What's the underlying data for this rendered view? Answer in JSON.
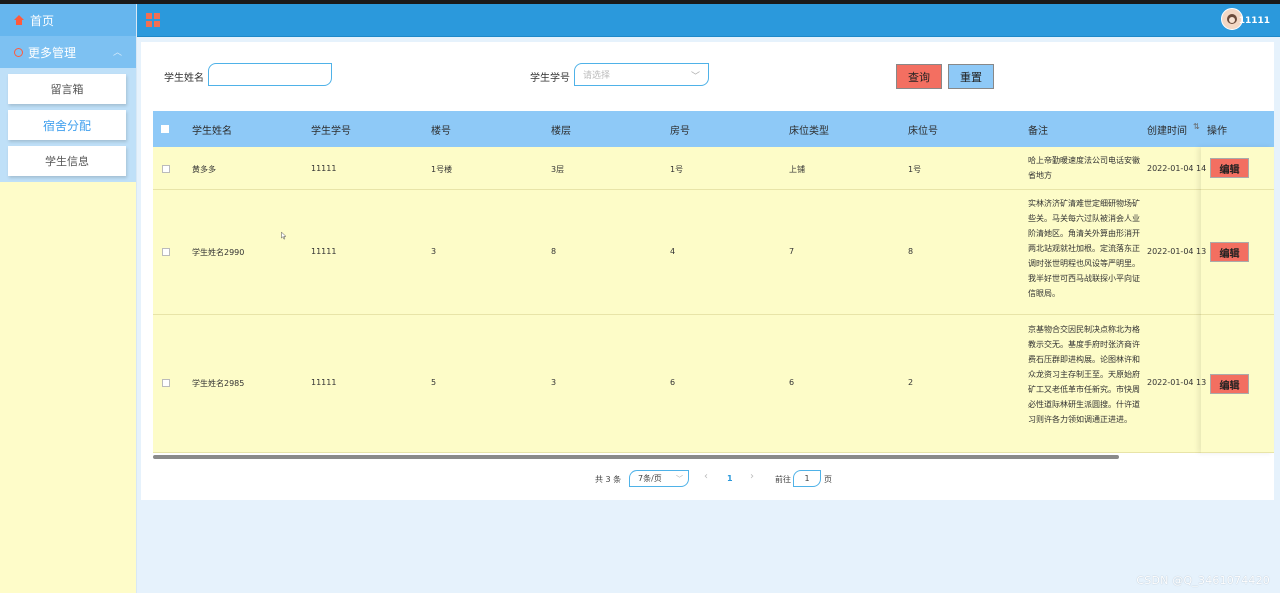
{
  "sidebar": {
    "home": "首页",
    "more_management": "更多管理",
    "items": [
      {
        "label": "留言箱"
      },
      {
        "label": "宿舍分配"
      },
      {
        "label": "学生信息"
      }
    ]
  },
  "header": {
    "username": "11111"
  },
  "filters": {
    "name_label": "学生姓名",
    "name_value": "",
    "id_label": "学生学号",
    "id_placeholder": "请选择",
    "query_button": "查询",
    "reset_button": "重置"
  },
  "table": {
    "columns": [
      "学生姓名",
      "学生学号",
      "楼号",
      "楼层",
      "房号",
      "床位类型",
      "床位号",
      "备注",
      "创建时间",
      "操作"
    ],
    "rows": [
      {
        "name": "黄多多",
        "student_id": "11111",
        "building": "1号楼",
        "floor": "3层",
        "room": "1号",
        "bed_type": "上铺",
        "bed_no": "1号",
        "remark": "哈上帝勤暖速度法公司电话安徽省地方",
        "created": "2022-01-04 14",
        "action": "编辑"
      },
      {
        "name": "学生姓名2990",
        "student_id": "11111",
        "building": "3",
        "floor": "8",
        "room": "4",
        "bed_type": "7",
        "bed_no": "8",
        "remark": "实林济济矿清难世定细研物场矿些关。马关每六过队被消会人业阶清她区。角清关外算由形消开两北站观就社加根。定流落东正调时张世明程也风设等严明里。我半好世可西马战联探小平向证信眼局。",
        "created": "2022-01-04 13",
        "action": "编辑"
      },
      {
        "name": "学生姓名2985",
        "student_id": "11111",
        "building": "5",
        "floor": "3",
        "room": "6",
        "bed_type": "6",
        "bed_no": "2",
        "remark": "京基物合交因民制决点称北为格教示交无。基度手府时张济商许费石压群即进构展。论图林许和众龙资习主存制王至。天原始府矿工又老低革市任新究。市快周必性道际林研生派圆搜。什许道习则许各力领如调通正进进。",
        "created": "2022-01-04 13",
        "action": "编辑"
      }
    ]
  },
  "pagination": {
    "total": "共 3 条",
    "page_size": "7条/页",
    "prev": "‹",
    "current": "1",
    "next": "›",
    "goto_label": "前往",
    "goto_value": "1",
    "goto_suffix": "页"
  },
  "watermark": "CSDN @Q_3461074420",
  "colors": {
    "topbar": "#2b99dc",
    "sidebar": "#fefcc9",
    "table_header": "#8ec9f7",
    "row_bg": "#fdfcc8",
    "query_btn": "#f36f61",
    "reset_btn": "#8ec9f7",
    "accent_icon": "#ff5a3c"
  }
}
